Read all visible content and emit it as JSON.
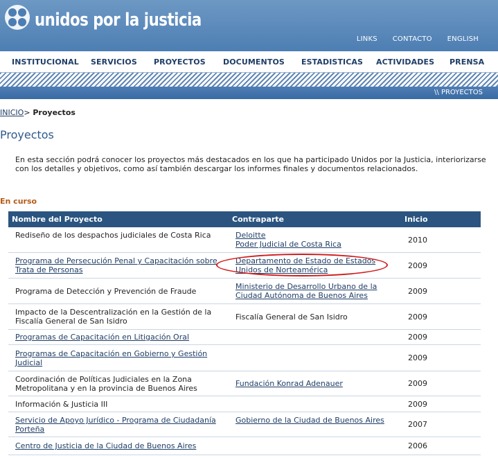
{
  "header": {
    "logo_text": "unidos por la justicia",
    "links": [
      "LINKS",
      "CONTACTO",
      "ENGLISH"
    ]
  },
  "nav": [
    "INSTITUCIONAL",
    "SERVICIOS",
    "PROYECTOS",
    "DOCUMENTOS",
    "ESTADISTICAS",
    "ACTIVIDADES",
    "PRENSA"
  ],
  "section_label": "\\\\ PROYECTOS",
  "breadcrumb": {
    "home": "INICIO",
    "sep": ">",
    "current": " Proyectos"
  },
  "page_title": "Proyectos",
  "intro": "En esta sección podrá conocer los proyectos más destacados en los que ha participado Unidos por la Justicia, interiorizarse con los detalles y objetivos, como así también descargar los informes finales y documentos relacionados.",
  "status_heading": "En curso",
  "table": {
    "headers": [
      "Nombre del Proyecto",
      "Contraparte",
      "Inicio"
    ],
    "rows": [
      {
        "name": "Rediseño de los despachos judiciales de Costa Rica",
        "name_link": false,
        "partner": [
          "Deloitte",
          "Poder Judicial de Costa Rica"
        ],
        "partner_link": true,
        "year": "2010"
      },
      {
        "name": "Programa de Persecución Penal y Capacitación sobre Trata de Personas",
        "name_link": true,
        "partner": [
          "Departamento de Estado de Estados Unidos de Norteamérica"
        ],
        "partner_link": true,
        "year": "2009"
      },
      {
        "name": "Programa de Detección y Prevención de Fraude",
        "name_link": false,
        "partner": [
          "Ministerio de Desarrollo Urbano de la Ciudad Autónoma de Buenos Aires"
        ],
        "partner_link": true,
        "year": "2009"
      },
      {
        "name": "Impacto de la Descentralización en la Gestión de la Fiscalía General de San Isidro",
        "name_link": false,
        "partner": [
          "Fiscalía General de San Isidro"
        ],
        "partner_link": false,
        "year": "2009"
      },
      {
        "name": "Programas de Capacitación en Litigación Oral",
        "name_link": true,
        "partner": [],
        "partner_link": false,
        "year": "2009"
      },
      {
        "name": "Programas de Capacitación en Gobierno y Gestión Judicial",
        "name_link": true,
        "partner": [],
        "partner_link": false,
        "year": "2009"
      },
      {
        "name": "Coordinación de Políticas Judiciales en la Zona Metropolitana y en la provincia de Buenos Aires",
        "name_link": false,
        "partner": [
          "Fundación Konrad Adenauer"
        ],
        "partner_link": true,
        "year": "2009"
      },
      {
        "name": "Información & Justicia III",
        "name_link": false,
        "partner": [],
        "partner_link": false,
        "year": "2009"
      },
      {
        "name": "Servicio de Apoyo Jurídico - Programa de Ciudadanía Porteña",
        "name_link": true,
        "partner": [
          "Gobierno de la Ciudad de Buenos Aires"
        ],
        "partner_link": true,
        "year": "2007"
      },
      {
        "name": "Centro de Justicia de la Ciudad de Buenos Aires",
        "name_link": true,
        "partner": [],
        "partner_link": false,
        "year": "2006"
      }
    ]
  },
  "colors": {
    "header_blue": "#4d7eb3",
    "table_header": "#2b5580",
    "link": "#1f3d66",
    "status_orange": "#b35a17",
    "annotation_red": "#d01a1a"
  }
}
